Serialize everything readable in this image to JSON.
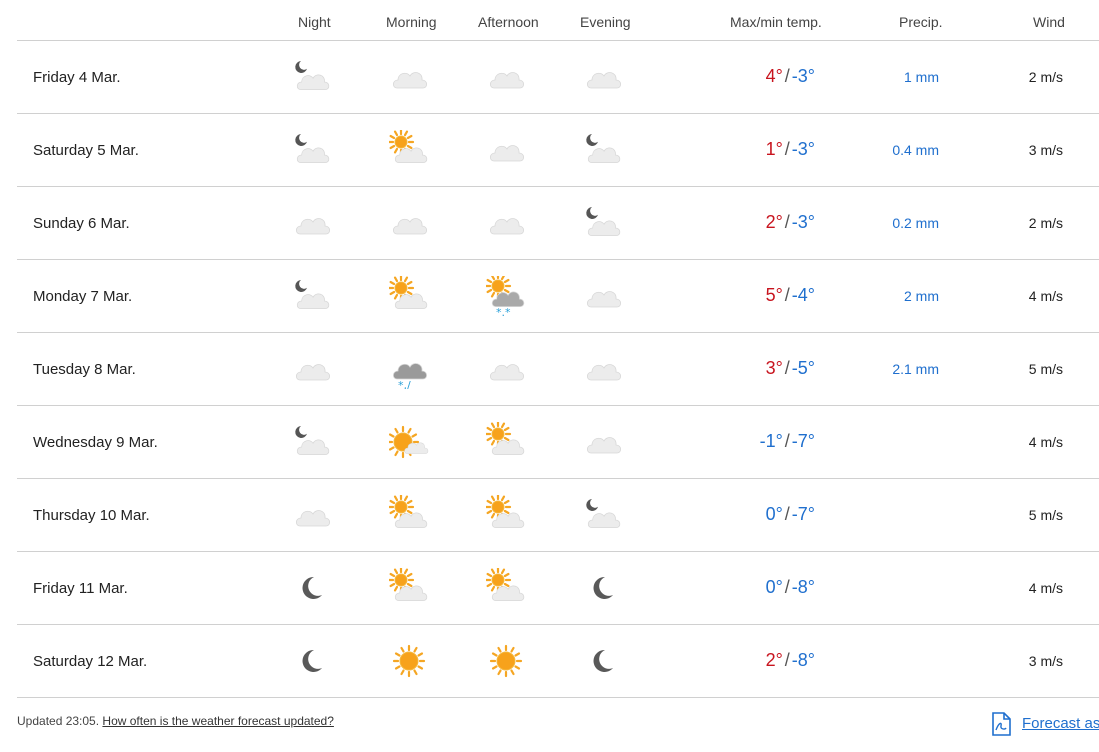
{
  "header": {
    "night": "Night",
    "morning": "Morning",
    "afternoon": "Afternoon",
    "evening": "Evening",
    "temp": "Max/min temp.",
    "precip": "Precip.",
    "wind": "Wind"
  },
  "temp_separator": "/",
  "colors": {
    "warm": "#c8141e",
    "cold": "#1f6fce",
    "link": "#1f6fce"
  },
  "rows": [
    {
      "day": "Friday 4 Mar.",
      "icons": [
        "partly-cloudy-night-icon",
        "cloudy-icon",
        "cloudy-icon",
        "cloudy-icon"
      ],
      "max": "4°",
      "min": "-3°",
      "warm": true,
      "precip": "1 mm",
      "wind": "2 m/s"
    },
    {
      "day": "Saturday 5 Mar.",
      "icons": [
        "partly-cloudy-night-icon",
        "partly-cloudy-day-icon",
        "cloudy-icon",
        "partly-cloudy-night-icon"
      ],
      "max": "1°",
      "min": "-3°",
      "warm": true,
      "precip": "0.4 mm",
      "wind": "3 m/s"
    },
    {
      "day": "Sunday 6 Mar.",
      "icons": [
        "cloudy-icon",
        "cloudy-icon",
        "cloudy-icon",
        "partly-cloudy-night-icon"
      ],
      "max": "2°",
      "min": "-3°",
      "warm": true,
      "precip": "0.2 mm",
      "wind": "2 m/s"
    },
    {
      "day": "Monday 7 Mar.",
      "icons": [
        "partly-cloudy-night-icon",
        "partly-cloudy-day-icon",
        "snow-showers-day-icon",
        "cloudy-icon"
      ],
      "max": "5°",
      "min": "-4°",
      "warm": true,
      "precip": "2 mm",
      "wind": "4 m/s"
    },
    {
      "day": "Tuesday 8 Mar.",
      "icons": [
        "cloudy-icon",
        "sleet-icon",
        "cloudy-icon",
        "cloudy-icon"
      ],
      "max": "3°",
      "min": "-5°",
      "warm": true,
      "precip": "2.1 mm",
      "wind": "5 m/s"
    },
    {
      "day": "Wednesday 9 Mar.",
      "icons": [
        "partly-cloudy-night-icon",
        "fair-day-icon",
        "partly-cloudy-day-icon",
        "cloudy-icon"
      ],
      "max": "-1°",
      "min": "-7°",
      "warm": false,
      "precip": "",
      "wind": "4 m/s"
    },
    {
      "day": "Thursday 10 Mar.",
      "icons": [
        "cloudy-icon",
        "partly-cloudy-day-icon",
        "partly-cloudy-day-icon",
        "partly-cloudy-night-icon"
      ],
      "max": "0°",
      "min": "-7°",
      "warm": false,
      "precip": "",
      "wind": "5 m/s"
    },
    {
      "day": "Friday 11 Mar.",
      "icons": [
        "clear-night-icon",
        "partly-cloudy-day-icon",
        "partly-cloudy-day-icon",
        "clear-night-icon"
      ],
      "max": "0°",
      "min": "-8°",
      "warm": false,
      "precip": "",
      "wind": "4 m/s"
    },
    {
      "day": "Saturday 12 Mar.",
      "icons": [
        "clear-night-icon",
        "clear-sun-icon",
        "clear-sun-icon",
        "clear-night-icon"
      ],
      "max": "2°",
      "min": "-8°",
      "warm": true,
      "precip": "",
      "wind": "3 m/s"
    }
  ],
  "footer": {
    "updated": "Updated 23:05.",
    "link": "How often is the weather forecast updated?",
    "pdf_label": "Forecast as"
  }
}
